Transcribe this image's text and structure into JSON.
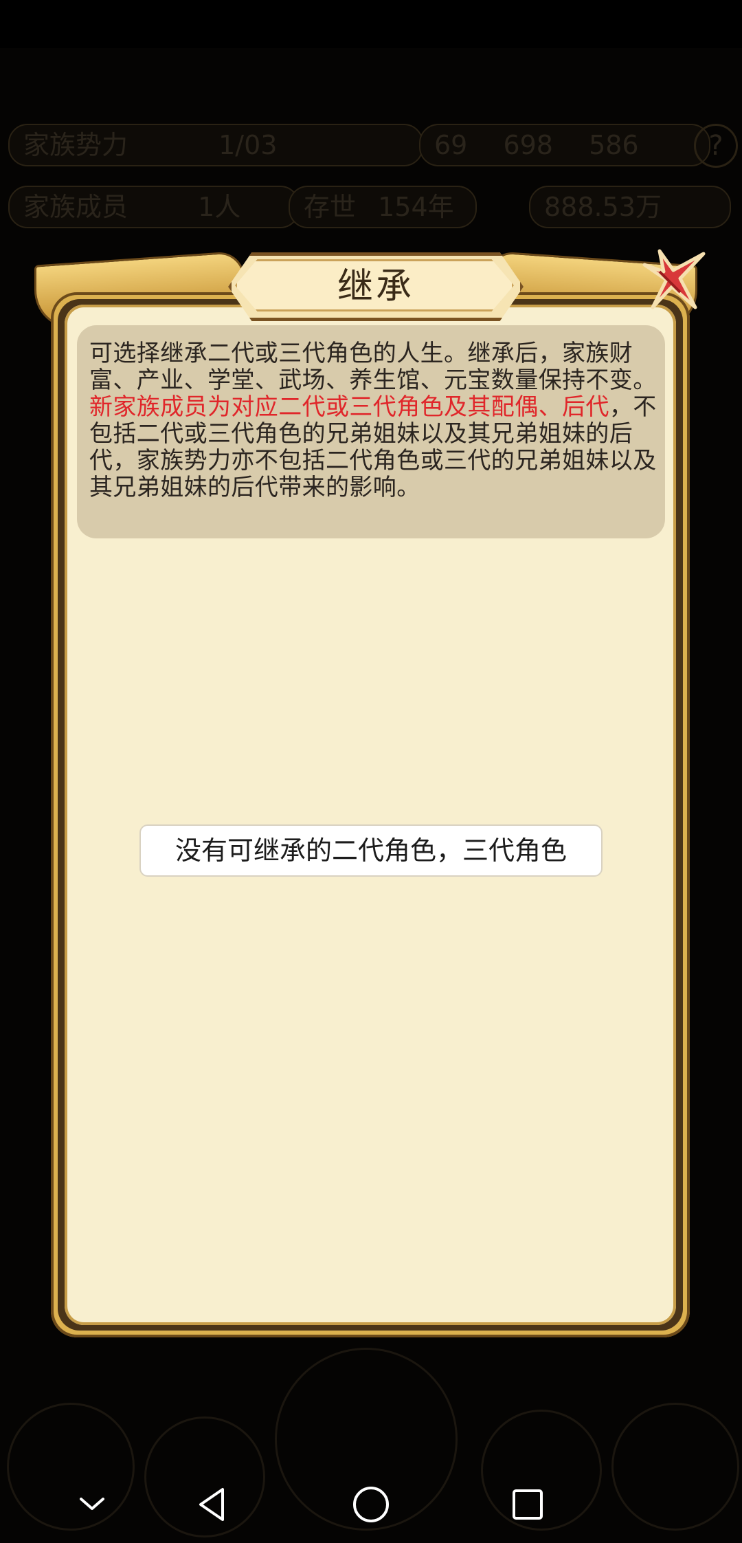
{
  "background": {
    "top_bar": {
      "family_power_label": "家族势力",
      "family_power_value": "1/03",
      "resource_a": "69",
      "resource_b": "698",
      "resource_c": "586"
    },
    "second_bar": {
      "members_label": "家族成员",
      "members_value": "1人",
      "era_label": "存世",
      "era_value": "154年",
      "money": "888.53万"
    }
  },
  "modal": {
    "title": "继承",
    "description_part1": "可选择继承二代或三代角色的人生。继承后，家族财富、产业、学堂、武场、养生馆、元宝数量保持不变。",
    "description_highlight": "新家族成员为对应二代或三代角色及其配偶、后代",
    "description_part2": "，不包括二代或三代角色的兄弟姐妹以及其兄弟姐妹的后代，家族势力亦不包括二代角色或三代的兄弟姐妹以及其兄弟姐妹的后代带来的影响。",
    "empty_message": "没有可继承的二代角色，三代角色",
    "close_icon": "close-x-icon"
  },
  "navbar": {
    "items": [
      "chevron-down-icon",
      "back-triangle-icon",
      "home-circle-icon",
      "recents-square-icon"
    ]
  },
  "colors": {
    "frame_gold": "#dcb14f",
    "panel_bg": "#f8efcf",
    "desc_bg": "#d8cbab",
    "highlight_red": "#e0262a",
    "close_red": "#d8383a"
  }
}
